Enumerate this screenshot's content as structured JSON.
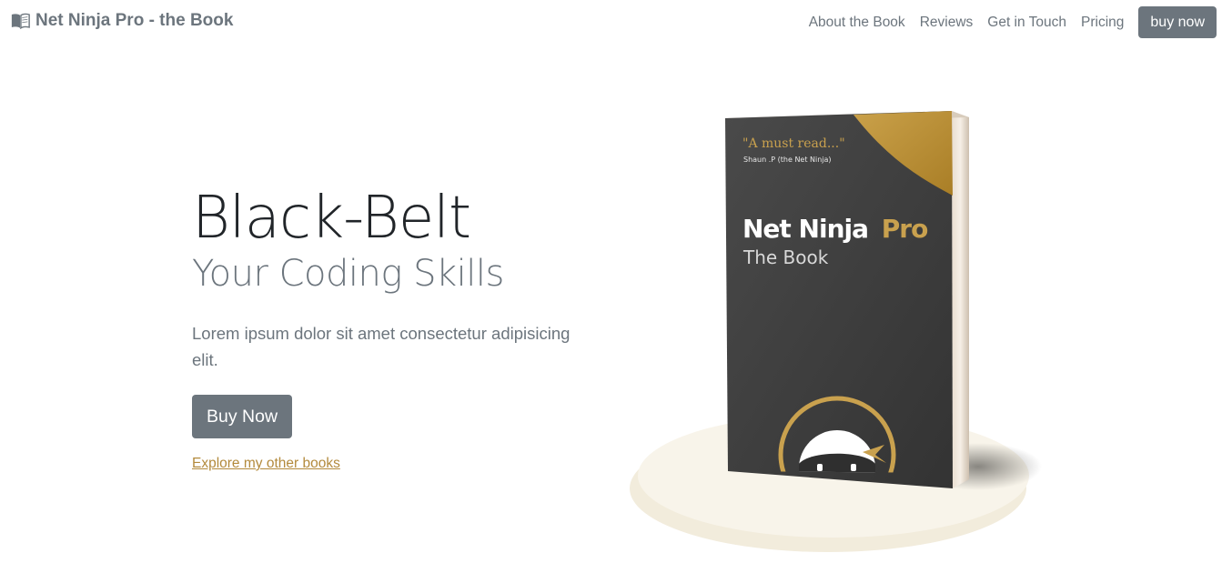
{
  "navbar": {
    "brand_icon": "book-open-icon",
    "brand_text": "Net Ninja Pro - the Book",
    "links": [
      "About the Book",
      "Reviews",
      "Get in Touch",
      "Pricing"
    ],
    "cta_label": "buy now"
  },
  "hero": {
    "title": "Black-Belt",
    "subtitle": "Your Coding Skills",
    "lead": "Lorem ipsum dolor sit amet consectetur adipisicing elit.",
    "button_label": "Buy Now",
    "link_text": "Explore my other books"
  },
  "book": {
    "quote": "\"A must read...\"",
    "quote_author": "Shaun .P (the Net Ninja)",
    "title_main": "Net Ninja",
    "title_accent": "Pro",
    "subtitle": "The Book",
    "logo_icon": "ninja-logo-icon"
  },
  "colors": {
    "muted": "#6c757d",
    "accent_gold": "#b38a3c",
    "book_cover": "#3d3d3d",
    "pedestal": "#f7f3e8"
  }
}
